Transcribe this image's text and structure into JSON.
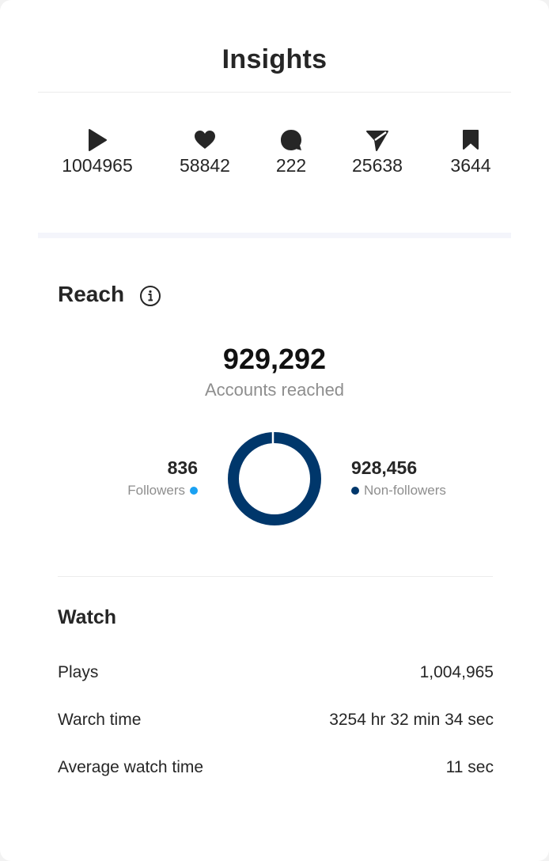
{
  "header": {
    "title": "Insights"
  },
  "stats": [
    {
      "icon": "play-icon",
      "value": "1004965"
    },
    {
      "icon": "heart-icon",
      "value": "58842"
    },
    {
      "icon": "comment-icon",
      "value": "222"
    },
    {
      "icon": "share-icon",
      "value": "25638"
    },
    {
      "icon": "bookmark-icon",
      "value": "3644"
    }
  ],
  "reach": {
    "heading": "Reach",
    "total": "929,292",
    "total_label": "Accounts reached",
    "followers": {
      "value": "836",
      "label": "Followers",
      "color": "#1aa1f2"
    },
    "non_followers": {
      "value": "928,456",
      "label": "Non-followers",
      "color": "#00376b"
    }
  },
  "watch": {
    "heading": "Watch",
    "rows": [
      {
        "label": "Plays",
        "value": "1,004,965"
      },
      {
        "label": "Warch time",
        "value": "3254 hr 32 min 34 sec"
      },
      {
        "label": "Average watch time",
        "value": "11 sec"
      }
    ]
  },
  "colors": {
    "icon": "#262626",
    "accent_dark": "#00376b",
    "accent_light": "#1aa1f2"
  }
}
